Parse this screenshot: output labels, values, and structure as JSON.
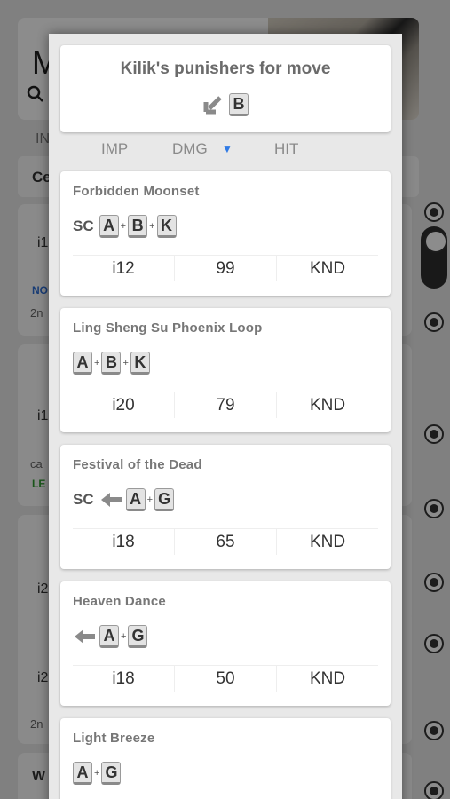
{
  "background": {
    "title_initial": "M",
    "tab_initial": "IN",
    "bar_initial": "Ce",
    "snippets": [
      "i1",
      "NO",
      "2n",
      "i1",
      "ca",
      "LE",
      "i2",
      "i2",
      "2n",
      "W"
    ]
  },
  "modal": {
    "title": "Kilik's punishers for move",
    "move": {
      "direction": "down-left-arrow-icon",
      "key": "B"
    },
    "sort": {
      "imp": "IMP",
      "dmg": "DMG",
      "dmg_arrow": "▼",
      "hit": "HIT"
    },
    "punishers": [
      {
        "name": "Forbidden Moonset",
        "prefix": "SC",
        "keys": [
          "A",
          "B",
          "K"
        ],
        "imp": "i12",
        "dmg": "99",
        "hit": "KND"
      },
      {
        "name": "Ling Sheng Su Phoenix Loop",
        "prefix": "",
        "keys": [
          "A",
          "B",
          "K"
        ],
        "imp": "i20",
        "dmg": "79",
        "hit": "KND"
      },
      {
        "name": "Festival of the Dead",
        "prefix": "SC",
        "direction": "left-arrow-icon",
        "keys": [
          "A",
          "G"
        ],
        "imp": "i18",
        "dmg": "65",
        "hit": "KND"
      },
      {
        "name": "Heaven Dance",
        "prefix": "",
        "direction": "left-arrow-icon",
        "keys": [
          "A",
          "G"
        ],
        "imp": "i18",
        "dmg": "50",
        "hit": "KND"
      },
      {
        "name": "Light Breeze",
        "prefix": "",
        "keys": [
          "A",
          "G"
        ]
      }
    ]
  }
}
